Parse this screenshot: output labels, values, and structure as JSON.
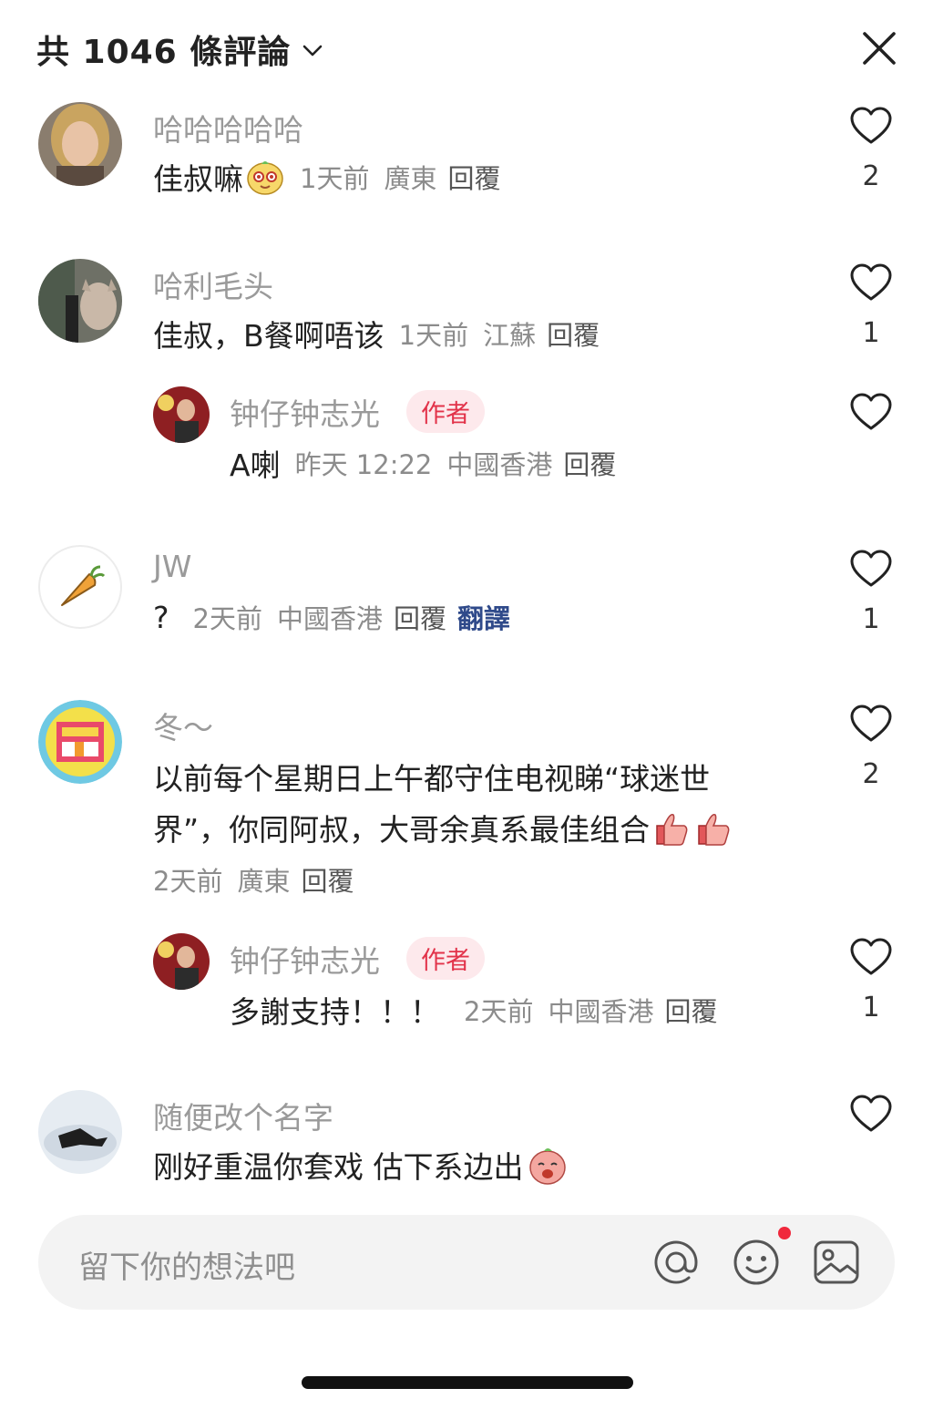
{
  "header": {
    "title": "共 1046 條評論"
  },
  "comments": [
    {
      "user": "哈哈哈哈哈",
      "text": "佳叔嘛",
      "time": "1天前",
      "location": "廣東",
      "reply": "回覆",
      "likes": "2"
    },
    {
      "user": "哈利毛头",
      "text": "佳叔，B餐啊唔该",
      "time": "1天前",
      "location": "江蘇",
      "reply": "回覆",
      "likes": "1",
      "subreply": {
        "user": "钟仔钟志光",
        "badge": "作者",
        "text": "A喇",
        "time": "昨天 12:22",
        "location": "中國香港",
        "reply": "回覆"
      }
    },
    {
      "user": "JW",
      "text": "?",
      "time": "2天前",
      "location": "中國香港",
      "reply": "回覆",
      "translate": "翻譯",
      "likes": "1"
    },
    {
      "user": "冬～",
      "text_line1": "以前每个星期日上午都守住电视睇“球迷世",
      "text_line2": "界”，你同阿叔，大哥余真系最佳组合",
      "time": "2天前",
      "location": "廣東",
      "reply": "回覆",
      "likes": "2",
      "subreply": {
        "user": "钟仔钟志光",
        "badge": "作者",
        "text": "多謝支持！！！",
        "time": "2天前",
        "location": "中國香港",
        "reply": "回覆",
        "likes": "1"
      }
    },
    {
      "user": "随便改个名字",
      "text": "刚好重温你套戏 估下系边出",
      "likes": ""
    }
  ],
  "input": {
    "placeholder": "留下你的想法吧"
  },
  "icons": {
    "close": "close-icon",
    "like": "heart-outline-icon",
    "at": "at-icon",
    "emoji": "smiley-icon",
    "image": "image-icon"
  },
  "colors": {
    "author_badge": "#e2334a",
    "notification_dot": "#f0283c",
    "translate": "#2f4a8a"
  }
}
